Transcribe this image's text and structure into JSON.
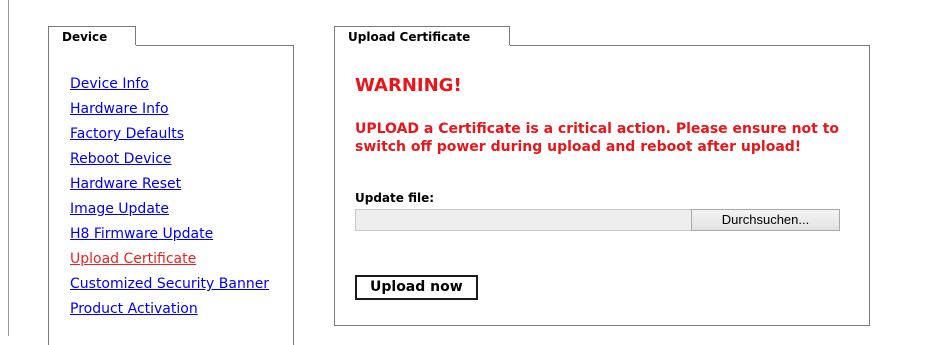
{
  "sidebar": {
    "tab_label": "Device",
    "items": [
      {
        "label": "Device Info"
      },
      {
        "label": "Hardware Info"
      },
      {
        "label": "Factory Defaults"
      },
      {
        "label": "Reboot Device"
      },
      {
        "label": "Hardware Reset"
      },
      {
        "label": "Image Update"
      },
      {
        "label": "H8 Firmware Update"
      },
      {
        "label": "Upload Certificate",
        "active": true
      },
      {
        "label": "Customized Security Banner"
      },
      {
        "label": "Product Activation"
      }
    ]
  },
  "main": {
    "tab_label": "Upload Certificate",
    "warning_title": "WARNING!",
    "warning_text": "UPLOAD a Certificate is a critical action. Please ensure not to switch off power during upload and reboot after upload!",
    "file_label": "Update file:",
    "file_value": "",
    "browse_label": "Durchsuchen...",
    "upload_label": "Upload now"
  },
  "colors": {
    "link": "#0000ee",
    "active_link": "#ee2222",
    "warning": "#e8161b"
  }
}
